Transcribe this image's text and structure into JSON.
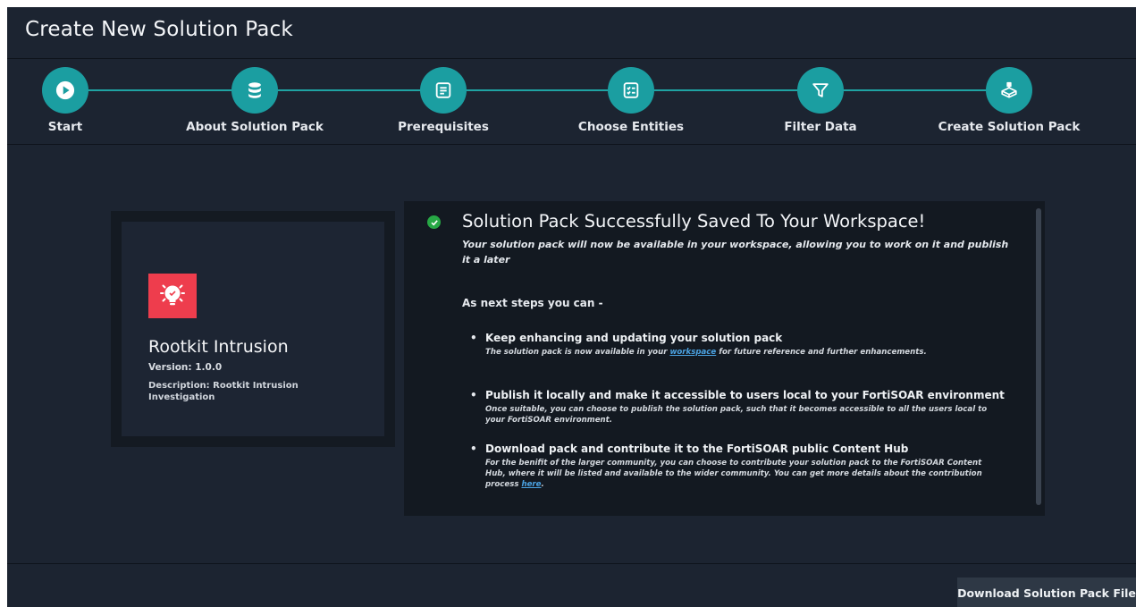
{
  "page_title": "Create New Solution Pack",
  "colors": {
    "background": "#1c2431",
    "accent": "#1b9ea1",
    "success": "#27a845",
    "pack_icon": "#ee3d4d",
    "link": "#4ba3e3"
  },
  "steps": [
    {
      "label": "Start",
      "icon": "play-icon"
    },
    {
      "label": "About Solution Pack",
      "icon": "database-icon"
    },
    {
      "label": "Prerequisites",
      "icon": "list-icon"
    },
    {
      "label": "Choose Entities",
      "icon": "checklist-icon"
    },
    {
      "label": "Filter Data",
      "icon": "filter-icon"
    },
    {
      "label": "Create Solution Pack",
      "icon": "package-icon"
    }
  ],
  "pack": {
    "icon": "lightbulb-icon",
    "name": "Rootkit Intrusion",
    "version": "Version: 1.0.0",
    "description": "Description: Rootkit Intrusion Investigation"
  },
  "success": {
    "title": "Solution Pack Successfully Saved To Your Workspace!",
    "subtitle": "Your solution pack will now be available in your workspace, allowing you to work on it and publish it a later",
    "next_steps_heading": "As next steps you can -",
    "items": [
      {
        "bullet": "•",
        "title": "Keep enhancing and updating your solution pack",
        "desc_before": "The solution pack is now available in your ",
        "link": "workspace",
        "desc_after": " for future reference and further enhancements."
      },
      {
        "bullet": "•",
        "title": "Publish it locally and make it accessible to users local to your FortiSOAR environment",
        "desc_before": "Once suitable, you can choose to publish the solution pack, such that it becomes accessible to all the users local to your FortiSOAR environment.",
        "link": "",
        "desc_after": ""
      },
      {
        "bullet": "•",
        "title": "Download pack and contribute it to the FortiSOAR public Content Hub",
        "desc_before": "For the benifit of the larger community, you can choose to contribute your solution pack to the FortiSOAR Content Hub, where it will be listed and available to the wider community. You can get more details about the contribution process ",
        "link": "here",
        "desc_after": "."
      }
    ]
  },
  "footer": {
    "download_label": "Download Solution Pack File"
  }
}
